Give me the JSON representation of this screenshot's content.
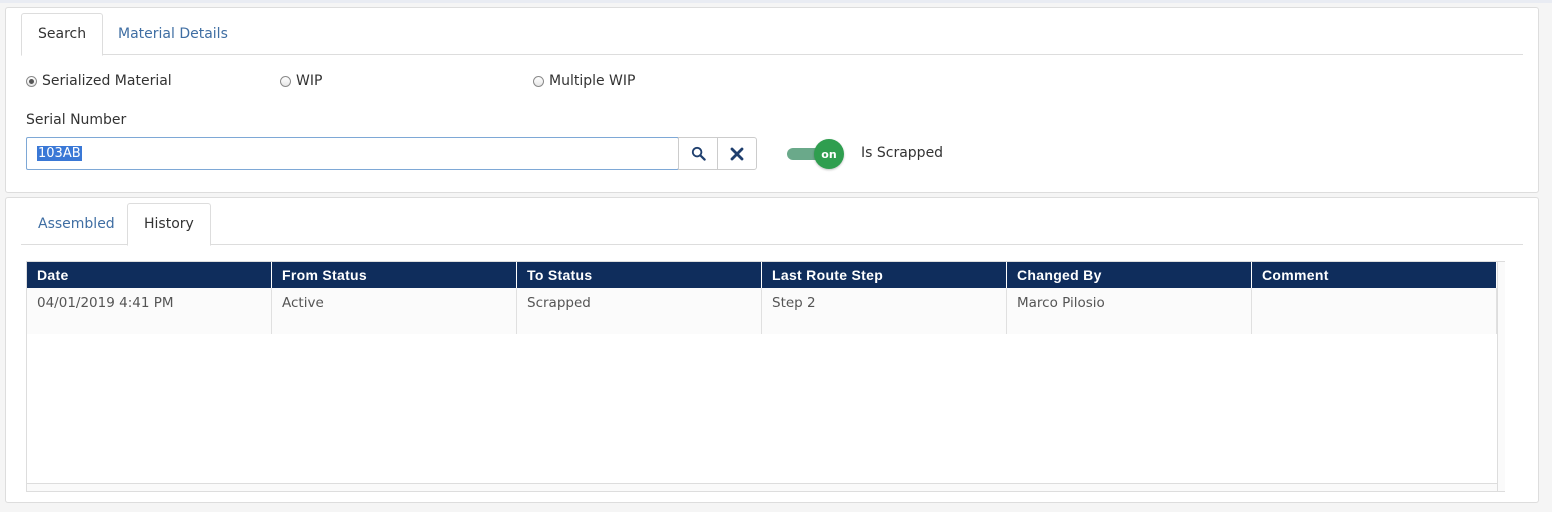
{
  "top_tabs": [
    {
      "label": "Search",
      "active": true
    },
    {
      "label": "Material Details",
      "active": false
    }
  ],
  "material_type": {
    "options": [
      "Serialized Material",
      "WIP",
      "Multiple WIP"
    ],
    "selected": "Serialized Material"
  },
  "serial_number": {
    "label": "Serial Number",
    "value": "103AB",
    "search_icon": "search-icon",
    "clear_icon": "close-icon"
  },
  "is_scrapped": {
    "toggle_text": "on",
    "label": "Is Scrapped",
    "state": true,
    "color": "#2f9e4f"
  },
  "bottom_tabs": [
    {
      "label": "Assembled",
      "active": false
    },
    {
      "label": "History",
      "active": true
    }
  ],
  "history_table": {
    "header_color": "#0f2d5c",
    "columns": [
      "Date",
      "From Status",
      "To Status",
      "Last Route Step",
      "Changed By",
      "Comment"
    ],
    "rows": [
      [
        "04/01/2019 4:41 PM",
        "Active",
        "Scrapped",
        "Step 2",
        "Marco Pilosio",
        ""
      ]
    ]
  },
  "colors": {
    "link_blue": "#3f6ea3",
    "selection": "#3a78d6"
  }
}
